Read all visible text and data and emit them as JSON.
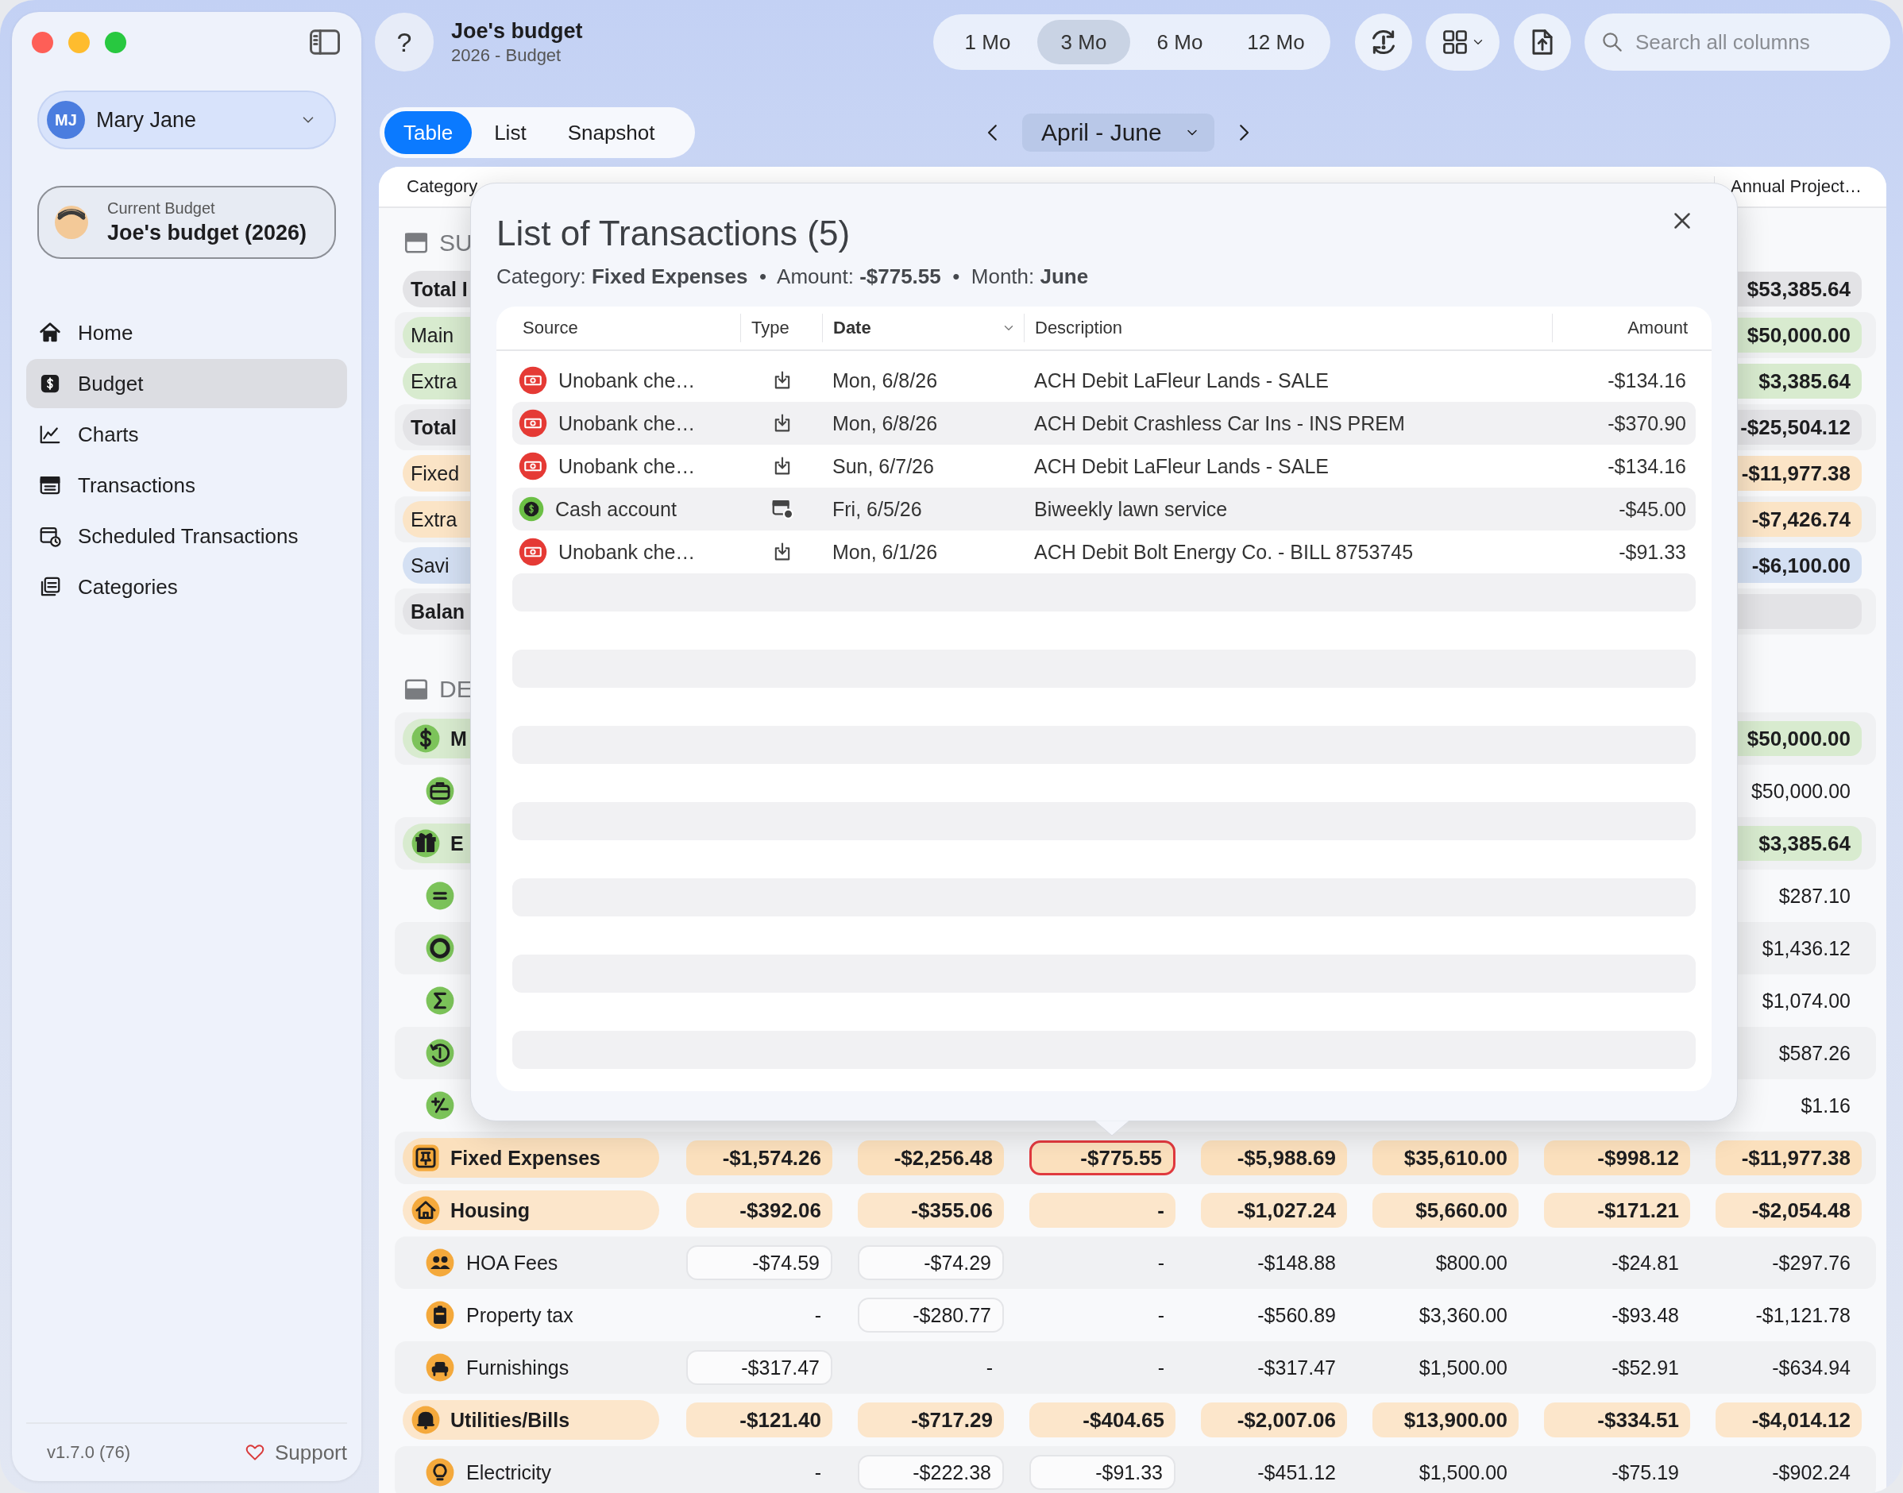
{
  "sidebar": {
    "user": {
      "initials": "MJ",
      "name": "Mary Jane"
    },
    "current_budget": {
      "label": "Current Budget",
      "name": "Joe's budget (2026)"
    },
    "nav": [
      {
        "label": "Home",
        "selected": false
      },
      {
        "label": "Budget",
        "selected": true
      },
      {
        "label": "Charts",
        "selected": false
      },
      {
        "label": "Transactions",
        "selected": false
      },
      {
        "label": "Scheduled Transactions",
        "selected": false
      },
      {
        "label": "Categories",
        "selected": false
      }
    ],
    "version": "v1.7.0 (76)",
    "support": "Support"
  },
  "toolbar": {
    "help": "?",
    "title": "Joe's budget",
    "subtitle": "2026 - Budget",
    "periods": [
      {
        "label": "1 Mo",
        "selected": false
      },
      {
        "label": "3 Mo",
        "selected": true
      },
      {
        "label": "6 Mo",
        "selected": false
      },
      {
        "label": "12 Mo",
        "selected": false
      }
    ],
    "search": {
      "placeholder": "Search all columns"
    }
  },
  "views": [
    {
      "label": "Table",
      "selected": true
    },
    {
      "label": "List",
      "selected": false
    },
    {
      "label": "Snapshot",
      "selected": false
    }
  ],
  "range": "April - June",
  "table": {
    "category_column": "Category",
    "column_8": "Annual Project…",
    "rows": [
      {
        "kind": "section",
        "label": "SU"
      },
      {
        "kind": "total",
        "label": "Total I",
        "color": "#e3e3e6",
        "cells": [
          null,
          null,
          null,
          null,
          null,
          null,
          {
            "text": "$53,385.64",
            "selected": false
          }
        ]
      },
      {
        "kind": "group",
        "label": "Main",
        "color": "#d8ebcf",
        "cells": [
          null,
          null,
          null,
          null,
          null,
          null,
          {
            "text": "$50,000.00",
            "selected": false
          }
        ]
      },
      {
        "kind": "group",
        "label": "Extra",
        "color": "#d8ebcf",
        "cells": [
          null,
          null,
          null,
          null,
          null,
          null,
          {
            "text": "$3,385.64",
            "selected": false
          }
        ]
      },
      {
        "kind": "total",
        "label": "Total",
        "color": "#e3e3e6",
        "cells": [
          null,
          null,
          null,
          null,
          null,
          null,
          {
            "text": "-$25,504.12",
            "selected": false
          }
        ]
      },
      {
        "kind": "group",
        "label": "Fixed",
        "color": "#fbe4c6",
        "cells": [
          null,
          null,
          null,
          null,
          null,
          null,
          {
            "text": "-$11,977.38",
            "selected": false
          }
        ]
      },
      {
        "kind": "group",
        "label": "Extra",
        "color": "#fbe4c6",
        "cells": [
          null,
          null,
          null,
          null,
          null,
          null,
          {
            "text": "-$7,426.74",
            "selected": false
          }
        ]
      },
      {
        "kind": "group",
        "label": "Savi",
        "color": "#d4e0f3",
        "cells": [
          null,
          null,
          null,
          null,
          null,
          null,
          {
            "text": "-$6,100.00",
            "selected": false
          }
        ]
      },
      {
        "kind": "total",
        "label": "Balan",
        "color": "#e3e3e6",
        "cells": [
          null,
          null,
          null,
          null,
          null,
          null,
          {
            "selected": false
          }
        ]
      },
      {
        "kind": "section",
        "label": "DE"
      },
      {
        "kind": "group",
        "label": "M",
        "color": "#d8ebcf",
        "cells": [
          null,
          null,
          null,
          null,
          null,
          null,
          {
            "text": "$50,000.00",
            "selected": false
          }
        ]
      },
      {
        "kind": "item",
        "color": "#7cc35a",
        "cells": [
          null,
          null,
          null,
          null,
          null,
          null,
          {
            "text": "$50,000.00",
            "entered": false,
            "selected": false
          }
        ]
      },
      {
        "kind": "group",
        "label": "E",
        "color": "#d8ebcf",
        "cells": [
          null,
          null,
          null,
          null,
          null,
          null,
          {
            "text": "$3,385.64",
            "selected": false
          }
        ]
      },
      {
        "kind": "item",
        "color": "#7cc35a",
        "cells": [
          null,
          null,
          null,
          null,
          null,
          null,
          {
            "text": "$287.10",
            "entered": false,
            "selected": false
          }
        ]
      },
      {
        "kind": "item",
        "color": "#7cc35a",
        "cells": [
          null,
          null,
          null,
          null,
          null,
          null,
          {
            "text": "$1,436.12",
            "entered": false,
            "selected": false
          }
        ]
      },
      {
        "kind": "item",
        "color": "#7cc35a",
        "cells": [
          null,
          null,
          null,
          null,
          null,
          null,
          {
            "text": "$1,074.00",
            "entered": false,
            "selected": false
          }
        ]
      },
      {
        "kind": "item",
        "color": "#7cc35a",
        "cells": [
          null,
          null,
          null,
          null,
          null,
          null,
          {
            "text": "$587.26",
            "entered": false,
            "selected": false
          }
        ]
      },
      {
        "kind": "item",
        "color": "#7cc35a",
        "cells": [
          null,
          null,
          null,
          null,
          null,
          null,
          {
            "text": "$1.16",
            "entered": false,
            "selected": false
          }
        ]
      },
      {
        "kind": "group",
        "label": "Fixed Expenses",
        "color": "#fbe0bd",
        "cells": [
          {
            "text": "-$1,574.26",
            "selected": false
          },
          {
            "text": "-$2,256.48",
            "selected": false
          },
          {
            "text": "-$775.55",
            "selected": true
          },
          {
            "text": "-$5,988.69",
            "selected": false
          },
          {
            "text": "$35,610.00",
            "selected": false
          },
          {
            "text": "-$998.12",
            "selected": false
          },
          {
            "text": "-$11,977.38",
            "selected": false
          }
        ]
      },
      {
        "kind": "group",
        "label": "Housing",
        "color": "#fce6cb",
        "cells": [
          {
            "text": "-$392.06",
            "selected": false
          },
          {
            "text": "-$355.06",
            "selected": false
          },
          {
            "text": "-",
            "selected": false
          },
          {
            "text": "-$1,027.24",
            "selected": false
          },
          {
            "text": "$5,660.00",
            "selected": false
          },
          {
            "text": "-$171.21",
            "selected": false
          },
          {
            "text": "-$2,054.48",
            "selected": false
          }
        ]
      },
      {
        "kind": "item",
        "label": "HOA Fees",
        "color": "#f4a93c",
        "cells": [
          {
            "text": "-$74.59",
            "entered": true,
            "selected": false
          },
          {
            "text": "-$74.29",
            "entered": true,
            "selected": false
          },
          {
            "text": "-",
            "entered": false,
            "selected": false
          },
          {
            "text": "-$148.88",
            "entered": false,
            "selected": false
          },
          {
            "text": "$800.00",
            "entered": false,
            "selected": false
          },
          {
            "text": "-$24.81",
            "entered": false,
            "selected": false
          },
          {
            "text": "-$297.76",
            "entered": false,
            "selected": false
          }
        ]
      },
      {
        "kind": "item",
        "label": "Property tax",
        "color": "#f4a93c",
        "cells": [
          {
            "text": "-",
            "entered": false,
            "selected": false
          },
          {
            "text": "-$280.77",
            "entered": true,
            "selected": false
          },
          {
            "text": "-",
            "entered": false,
            "selected": false
          },
          {
            "text": "-$560.89",
            "entered": false,
            "selected": false
          },
          {
            "text": "$3,360.00",
            "entered": false,
            "selected": false
          },
          {
            "text": "-$93.48",
            "entered": false,
            "selected": false
          },
          {
            "text": "-$1,121.78",
            "entered": false,
            "selected": false
          }
        ]
      },
      {
        "kind": "item",
        "label": "Furnishings",
        "color": "#f4a93c",
        "cells": [
          {
            "text": "-$317.47",
            "entered": true,
            "selected": false
          },
          {
            "text": "-",
            "entered": false,
            "selected": false
          },
          {
            "text": "-",
            "entered": false,
            "selected": false
          },
          {
            "text": "-$317.47",
            "entered": false,
            "selected": false
          },
          {
            "text": "$1,500.00",
            "entered": false,
            "selected": false
          },
          {
            "text": "-$52.91",
            "entered": false,
            "selected": false
          },
          {
            "text": "-$634.94",
            "entered": false,
            "selected": false
          }
        ]
      },
      {
        "kind": "group",
        "label": "Utilities/Bills",
        "color": "#fce6cb",
        "cells": [
          {
            "text": "-$121.40",
            "selected": false
          },
          {
            "text": "-$717.29",
            "selected": false
          },
          {
            "text": "-$404.65",
            "selected": false
          },
          {
            "text": "-$2,007.06",
            "selected": false
          },
          {
            "text": "$13,900.00",
            "selected": false
          },
          {
            "text": "-$334.51",
            "selected": false
          },
          {
            "text": "-$4,014.12",
            "selected": false
          }
        ]
      },
      {
        "kind": "item",
        "label": "Electricity",
        "color": "#f4a93c",
        "cells": [
          {
            "text": "-",
            "entered": false,
            "selected": false
          },
          {
            "text": "-$222.38",
            "entered": true,
            "selected": false
          },
          {
            "text": "-$91.33",
            "entered": true,
            "selected": false
          },
          {
            "text": "-$451.12",
            "entered": false,
            "selected": false
          },
          {
            "text": "$1,500.00",
            "entered": false,
            "selected": false
          },
          {
            "text": "-$75.19",
            "entered": false,
            "selected": false
          },
          {
            "text": "-$902.24",
            "entered": false,
            "selected": false
          }
        ]
      }
    ]
  },
  "popover": {
    "title": "List of Transactions (5)",
    "summary": "Category: **Fixed Expenses**  •  Amount: **-$775.55**  •  Month: **June**",
    "columns": [
      {
        "label": "Source",
        "sorted": false
      },
      {
        "label": "Type",
        "sorted": false
      },
      {
        "label": "Date",
        "sorted": true
      },
      {
        "label": "Description",
        "sorted": false
      },
      {
        "label": "Amount",
        "sorted": false
      }
    ],
    "transactions": [
      {
        "kind": "bank",
        "source": "Unobank che…",
        "date": "Mon, 6/8/26",
        "description": "ACH Debit LaFleur Lands - SALE",
        "amount": "-$134.16"
      },
      {
        "kind": "bank",
        "source": "Unobank che…",
        "date": "Mon, 6/8/26",
        "description": "ACH Debit Crashless Car Ins - INS PREM",
        "amount": "-$370.90"
      },
      {
        "kind": "bank",
        "source": "Unobank che…",
        "date": "Sun, 6/7/26",
        "description": "ACH Debit LaFleur Lands - SALE",
        "amount": "-$134.16"
      },
      {
        "kind": "cash",
        "source": "Cash account",
        "date": "Fri, 6/5/26",
        "description": "Biweekly lawn service",
        "amount": "-$45.00"
      },
      {
        "kind": "bank",
        "source": "Unobank che…",
        "date": "Mon, 6/1/26",
        "description": "ACH Debit Bolt Energy Co. - BILL  8753745",
        "amount": "-$91.33"
      }
    ]
  }
}
